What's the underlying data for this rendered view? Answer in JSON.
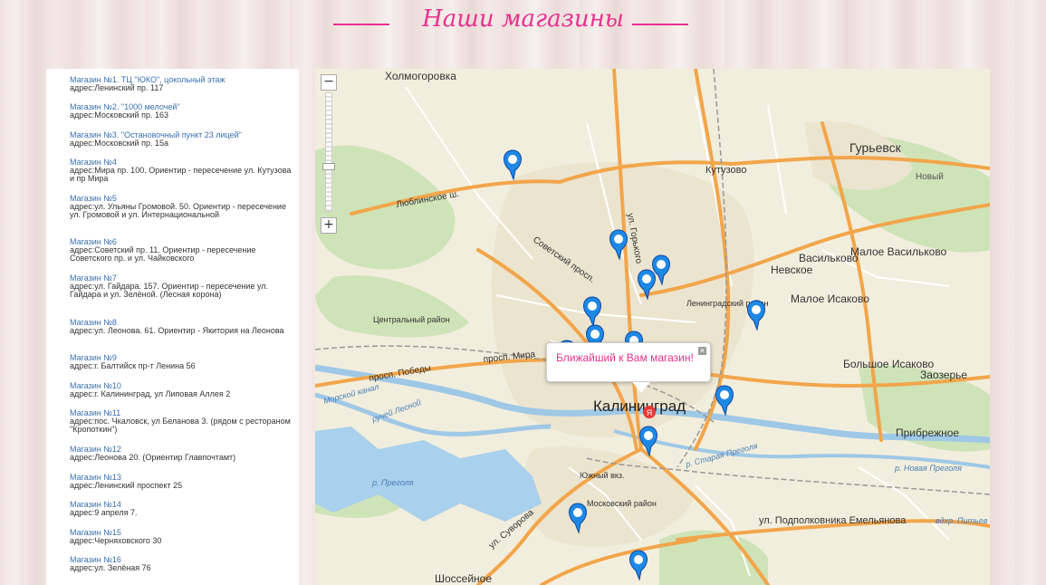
{
  "page_title": "Наши магазины",
  "shops": [
    {
      "name": "Магазин №1. ТЦ \"ЮКО\", цокольный этаж",
      "address": "адрес:Ленинский пр. 117"
    },
    {
      "name": "Магазин №2. \"1000 мелочей\"",
      "address": "адрес:Московский пр. 163"
    },
    {
      "name": "Магазин №3. \"Остановочный пункт 23 лицей\"",
      "address": "адрес:Московский пр. 15а"
    },
    {
      "name": "Магазин №4",
      "address": "адрес:Мира пр. 100. Ориентир - пересечение ул. Кутузова и пр Мира"
    },
    {
      "name": "Магазин №5",
      "address": "адрес:ул. Ульяны Громовой. 50. Ориентир - пересечение ул. Громовой и ул. Интернациональной"
    },
    {
      "name": "Магазин №6",
      "address": "адрес:Советский пр. 11. Ориентир - пересечение Советского пр. и ул. Чайковского"
    },
    {
      "name": "Магазин №7",
      "address": "адрес:ул. Гайдара. 157. Ориентир - пересечение ул. Гайдара и ул. Зелёной. (Лесная корона)"
    },
    {
      "name": "Магазин №8",
      "address": "адрес:ул. Леонова. 61. Ориентир - Якитория на Леонова"
    },
    {
      "name": "Магазин №9",
      "address": "адрес:г. Балтийск пр-т Ленина 56"
    },
    {
      "name": "Магазин №10",
      "address": "адрес:г. Калининград, ул Липовая Аллея 2"
    },
    {
      "name": "Магазин №11",
      "address": "адрес:пос. Чкаловск, ул Беланова 3. (рядом с рестораном \"Кропоткин\")"
    },
    {
      "name": "Магазин №12",
      "address": "адрес:Леонова 20. (Ориентир Главпочтамт)"
    },
    {
      "name": "Магазин №13",
      "address": "адрес:Ленинский проспект 25"
    },
    {
      "name": "Магазин №14",
      "address": "адрес:9 апреля 7."
    },
    {
      "name": "Магазин №15",
      "address": "адрес:Черняховского 30"
    },
    {
      "name": "Магазин №16",
      "address": "адрес:ул. Зелёная 76"
    }
  ],
  "map": {
    "zoom_in": "+",
    "zoom_out": "−",
    "popup_text": "Ближайший к Вам магазин!",
    "popup_close": "✕",
    "user_marker": "Я",
    "places": {
      "kholmogorovka": "Холмогоровка",
      "guryevsk": "Гурьевск",
      "kutuzovo": "Кутузово",
      "novy": "Новый",
      "lyublinskoe": "Люблинское ш.",
      "sovetsky": "Советский просп.",
      "gorkogo": "ул. Горького",
      "malo_vasilkovo": "Малое Васильково",
      "vasilkovo": "Васильково",
      "nevskoe": "Невское",
      "leningradsky": "Ленинградский район",
      "malo_isakovo": "Малое Исаково",
      "centralny": "Центральный район",
      "mira": "просп. Мира",
      "pobedy": "просп. Победы",
      "bolshoe_isakovo": "Большое Исаково",
      "zaozerye": "Заозерье",
      "kaliningrad": "Калининград",
      "ruchey": "ручей Лесной",
      "kanal": "Морской канал",
      "pribrezhnoe": "Прибрежное",
      "staraya_pregolya": "р. Старая Преголя",
      "novaya_pregolya": "р. Новая Преголя",
      "pregolya": "р. Преголя",
      "yuzhny": "Южный вкз.",
      "moskovsky": "Московский район",
      "suvorova": "ул. Суворова",
      "podpolkovnika": "ул. Подполковника Емельянова",
      "shosseynoe": "Шоссейное",
      "pitev": "вдхр. Питьев"
    }
  }
}
